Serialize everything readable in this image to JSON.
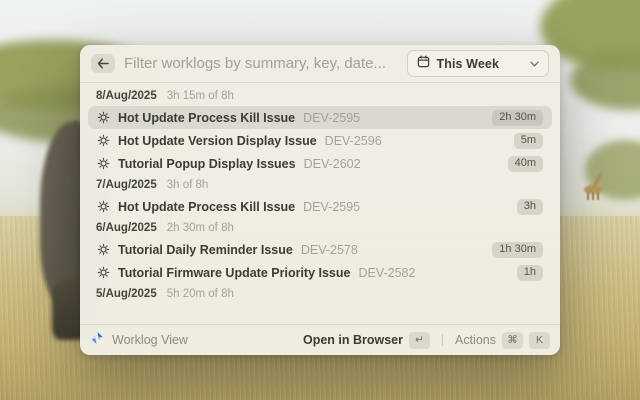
{
  "header": {
    "back_icon": "arrow-left-icon",
    "search_placeholder": "Filter worklogs by summary, key, date...",
    "dropdown": {
      "icon": "calendar-icon",
      "label": "This Week",
      "chevron": "chevron-down-icon"
    }
  },
  "sections": [
    {
      "date": "8/Aug/2025",
      "total": "3h 15m of 8h",
      "rows": [
        {
          "icon": "bug-icon",
          "title": "Hot Update Process Kill Issue",
          "key": "DEV-2595",
          "duration": "2h 30m",
          "selected": true
        },
        {
          "icon": "bug-icon",
          "title": "Hot Update Version Display Issue",
          "key": "DEV-2596",
          "duration": "5m",
          "selected": false
        },
        {
          "icon": "bug-icon",
          "title": "Tutorial Popup Display Issues",
          "key": "DEV-2602",
          "duration": "40m",
          "selected": false
        }
      ]
    },
    {
      "date": "7/Aug/2025",
      "total": "3h of 8h",
      "rows": [
        {
          "icon": "bug-icon",
          "title": "Hot Update Process Kill Issue",
          "key": "DEV-2595",
          "duration": "3h",
          "selected": false
        }
      ]
    },
    {
      "date": "6/Aug/2025",
      "total": "2h 30m of 8h",
      "rows": [
        {
          "icon": "bug-icon",
          "title": "Tutorial Daily Reminder Issue",
          "key": "DEV-2578",
          "duration": "1h 30m",
          "selected": false
        },
        {
          "icon": "bug-icon",
          "title": "Tutorial Firmware Update Priority Issue",
          "key": "DEV-2582",
          "duration": "1h",
          "selected": false
        }
      ]
    },
    {
      "date": "5/Aug/2025",
      "total": "5h 20m of 8h",
      "rows": []
    }
  ],
  "footer": {
    "app_icon": "jira-icon",
    "app_name": "Worklog View",
    "primary_action": "Open in Browser",
    "primary_key": "↵",
    "secondary_action": "Actions",
    "secondary_keys": [
      "⌘",
      "K"
    ]
  },
  "colors": {
    "panel_bg": "#f0ede4",
    "selected_row_bg": "#dbd8d1",
    "badge_bg": "#d6d3c9",
    "accent_blue": "#1d6ae5",
    "muted_text": "#a4a196",
    "dark_text": "#3c3b34"
  }
}
